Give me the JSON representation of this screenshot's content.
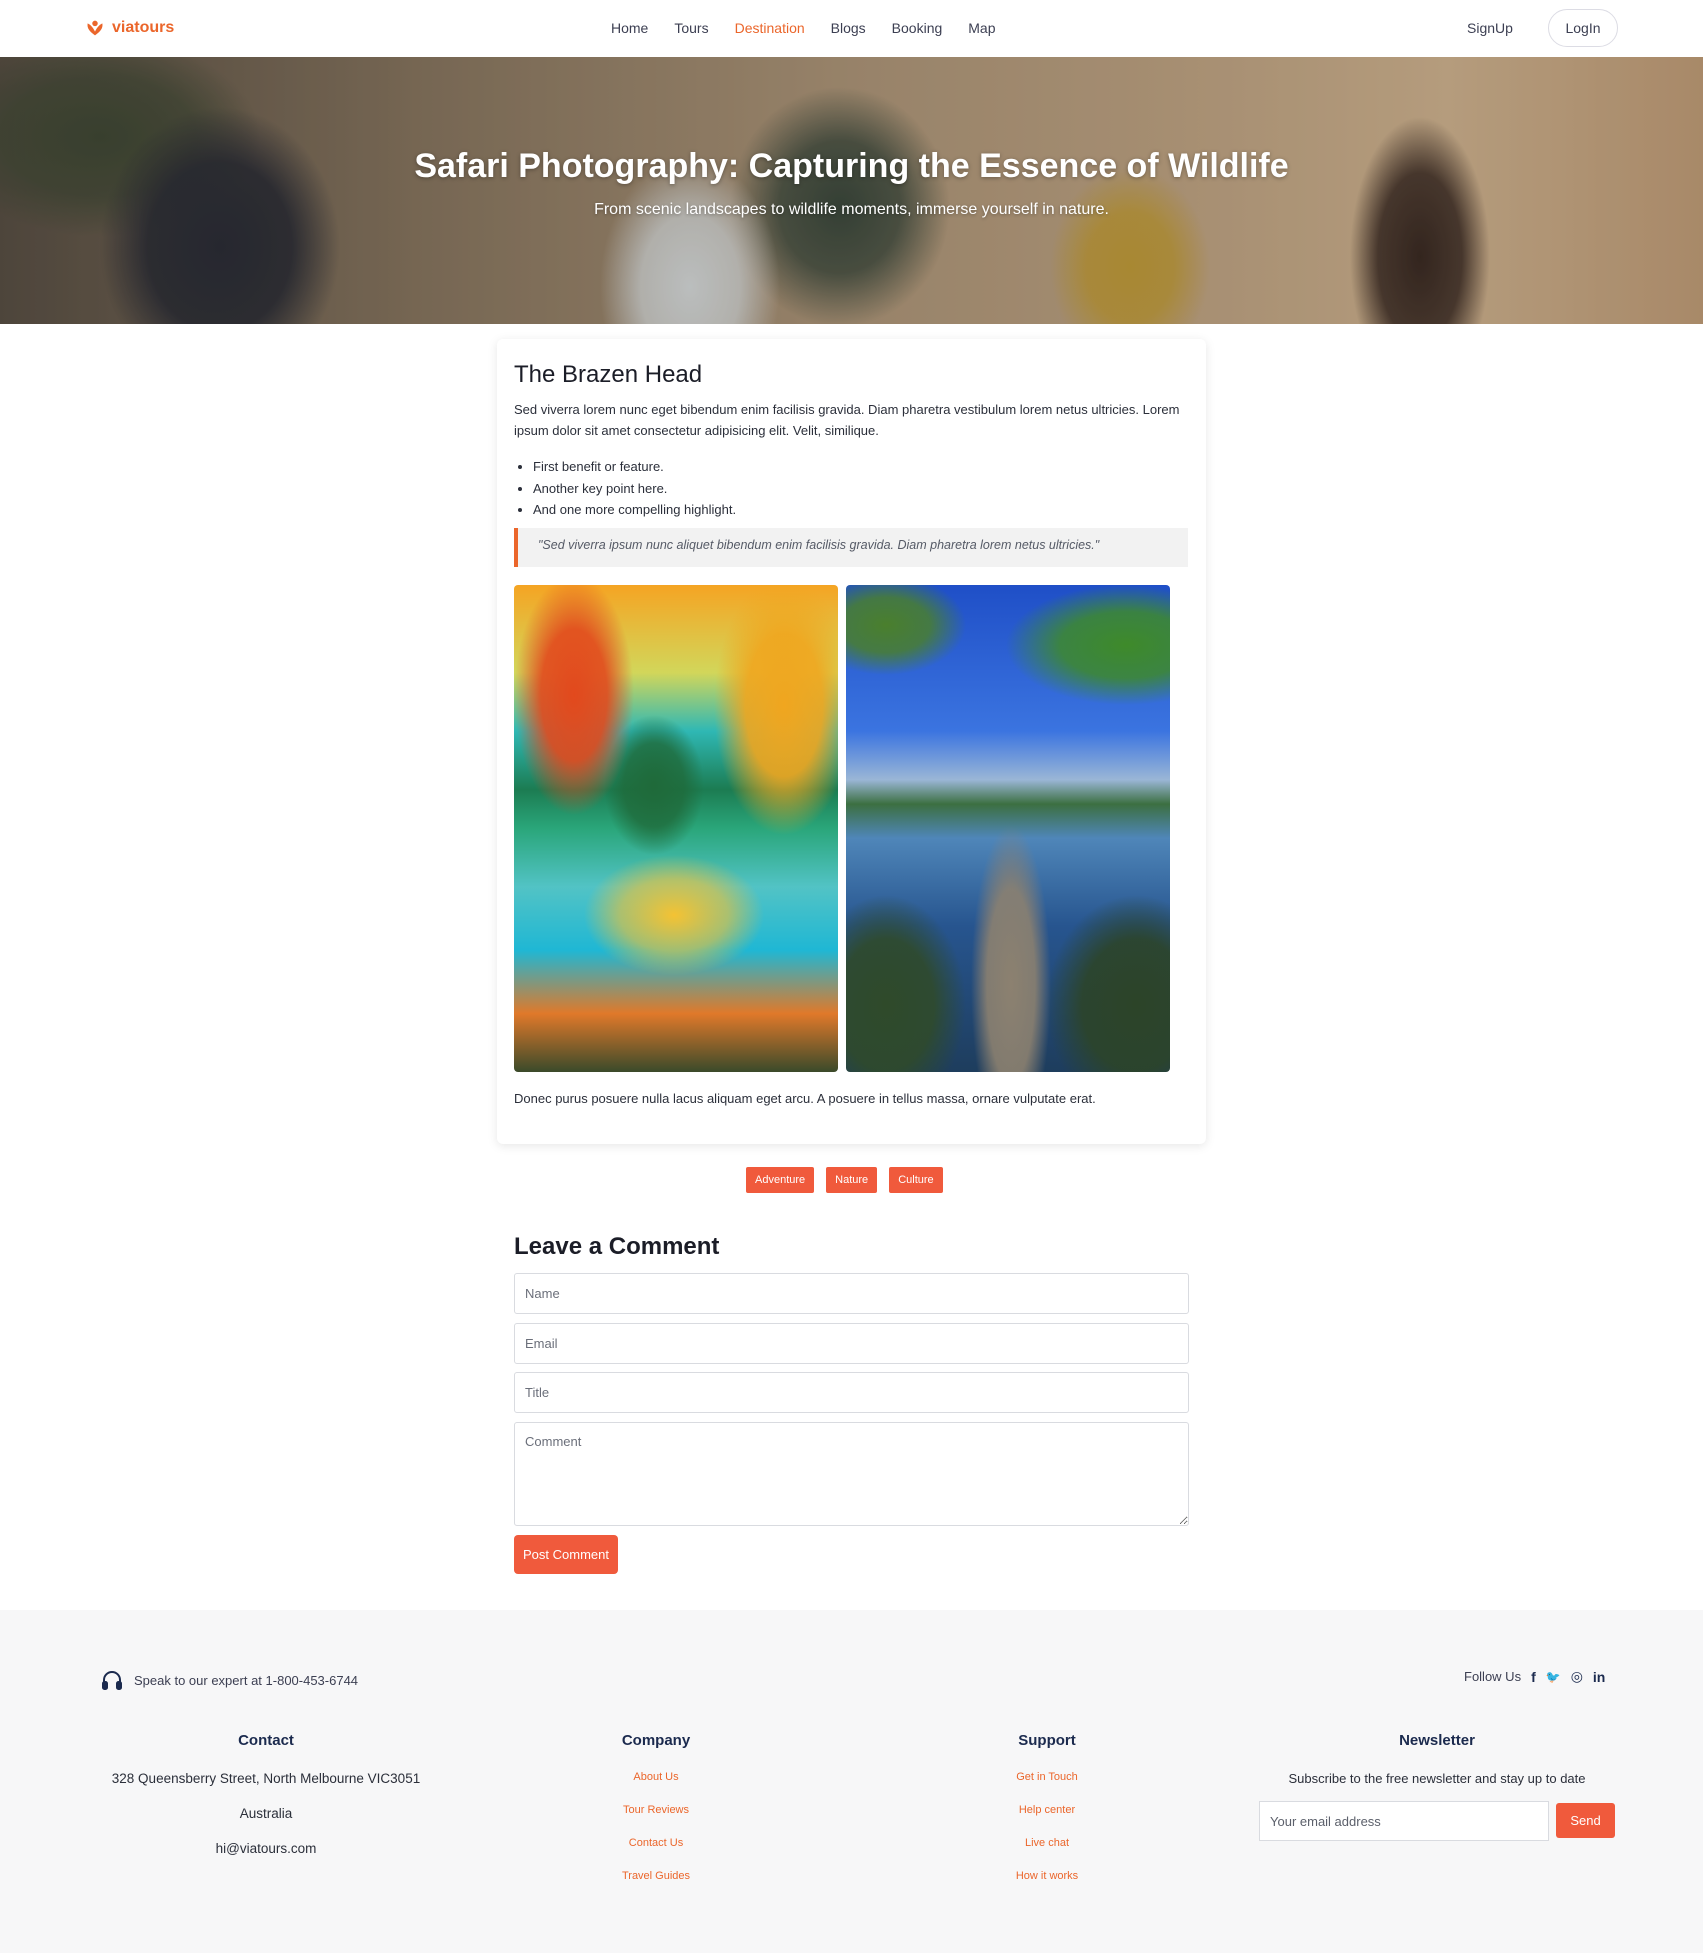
{
  "header": {
    "logo_text": "viatours",
    "nav": [
      {
        "label": "Home",
        "active": false
      },
      {
        "label": "Tours",
        "active": false
      },
      {
        "label": "Destination",
        "active": true
      },
      {
        "label": "Blogs",
        "active": false
      },
      {
        "label": "Booking",
        "active": false
      },
      {
        "label": "Map",
        "active": false
      }
    ],
    "signup_label": "SignUp",
    "login_label": "LogIn"
  },
  "hero": {
    "title": "Safari Photography: Capturing the Essence of Wildlife",
    "subtitle": "From scenic landscapes to wildlife moments, immerse yourself in nature."
  },
  "article": {
    "heading": "The Brazen Head",
    "intro": "Sed viverra lorem nunc eget bibendum enim facilisis gravida. Diam pharetra vestibulum lorem netus ultricies. Lorem ipsum dolor sit amet consectetur adipisicing elit. Velit, similique.",
    "bullets": [
      "First benefit or feature.",
      "Another key point here.",
      "And one more compelling highlight."
    ],
    "quote": "\"Sed viverra ipsum nunc aliquet bibendum enim facilisis gravida. Diam pharetra lorem netus ultricies.\"",
    "outro": "Donec purus posuere nulla lacus aliquam eget arcu. A posuere in tellus massa, ornare vulputate erat."
  },
  "tags": [
    "Adventure",
    "Nature",
    "Culture"
  ],
  "comment_form": {
    "title": "Leave a Comment",
    "name_placeholder": "Name",
    "email_placeholder": "Email",
    "title_placeholder": "Title",
    "comment_placeholder": "Comment",
    "submit_label": "Post Comment"
  },
  "footer": {
    "expert_text": "Speak to our expert at 1-800-453-6744",
    "follow_label": "Follow Us",
    "social": [
      {
        "icon": "facebook-icon",
        "glyph": "f"
      },
      {
        "icon": "twitter-icon",
        "glyph": "🐦"
      },
      {
        "icon": "instagram-icon",
        "glyph": "◎"
      },
      {
        "icon": "linkedin-icon",
        "glyph": "in"
      }
    ],
    "contact": {
      "heading": "Contact",
      "address": "328 Queensberry Street, North Melbourne VIC3051",
      "country": "Australia",
      "email": "hi@viatours.com"
    },
    "company": {
      "heading": "Company",
      "links": [
        "About Us",
        "Tour Reviews",
        "Contact Us",
        "Travel Guides"
      ]
    },
    "support": {
      "heading": "Support",
      "links": [
        "Get in Touch",
        "Help center",
        "Live chat",
        "How it works"
      ]
    },
    "newsletter": {
      "heading": "Newsletter",
      "text": "Subscribe to the free newsletter and stay up to date",
      "placeholder": "Your email address",
      "button": "Send"
    }
  },
  "colors": {
    "accent": "#eb662b",
    "button": "#f05a3c",
    "heading_dark": "#1b2a4e"
  }
}
